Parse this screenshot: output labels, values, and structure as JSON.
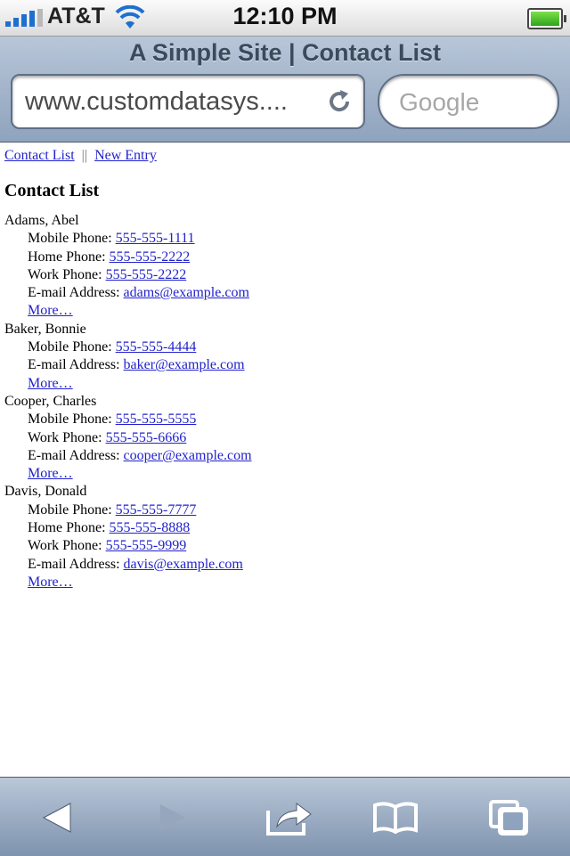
{
  "status_bar": {
    "carrier": "AT&T",
    "time": "12:10 PM",
    "icons": [
      "signal-bars-icon",
      "wifi-icon",
      "battery-icon"
    ]
  },
  "browser": {
    "page_title": "A Simple Site | Contact List",
    "url": "www.customdatasys....",
    "search_placeholder": "Google"
  },
  "nav": {
    "contact_list": "Contact List",
    "separator": "||",
    "new_entry": "New Entry"
  },
  "heading": "Contact List",
  "contacts": [
    {
      "name": "Adams, Abel",
      "fields": [
        {
          "label": "Mobile Phone:",
          "value": "555-555-1111"
        },
        {
          "label": "Home Phone:",
          "value": "555-555-2222"
        },
        {
          "label": "Work Phone:",
          "value": "555-555-2222"
        },
        {
          "label": "E-mail Address:",
          "value": "adams@example.com"
        }
      ],
      "more": "More…"
    },
    {
      "name": "Baker, Bonnie",
      "fields": [
        {
          "label": "Mobile Phone:",
          "value": "555-555-4444"
        },
        {
          "label": "E-mail Address:",
          "value": "baker@example.com"
        }
      ],
      "more": "More…"
    },
    {
      "name": "Cooper, Charles",
      "fields": [
        {
          "label": "Mobile Phone:",
          "value": "555-555-5555"
        },
        {
          "label": "Work Phone:",
          "value": "555-555-6666"
        },
        {
          "label": "E-mail Address:",
          "value": "cooper@example.com"
        }
      ],
      "more": "More…"
    },
    {
      "name": "Davis, Donald",
      "fields": [
        {
          "label": "Mobile Phone:",
          "value": "555-555-7777"
        },
        {
          "label": "Home Phone:",
          "value": "555-555-8888"
        },
        {
          "label": "Work Phone:",
          "value": "555-555-9999"
        },
        {
          "label": "E-mail Address:",
          "value": "davis@example.com"
        }
      ],
      "more": "More…"
    }
  ],
  "toolbar": {
    "icons": [
      "back-arrow-icon",
      "forward-arrow-icon",
      "share-icon",
      "bookmarks-icon",
      "tabs-icon"
    ]
  },
  "colors": {
    "link": "#2222cc",
    "chrome_top": "#b8c6d8",
    "chrome_bottom": "#8ea3bd",
    "battery": "#2ea41c",
    "signal": "#1f6fd0"
  }
}
